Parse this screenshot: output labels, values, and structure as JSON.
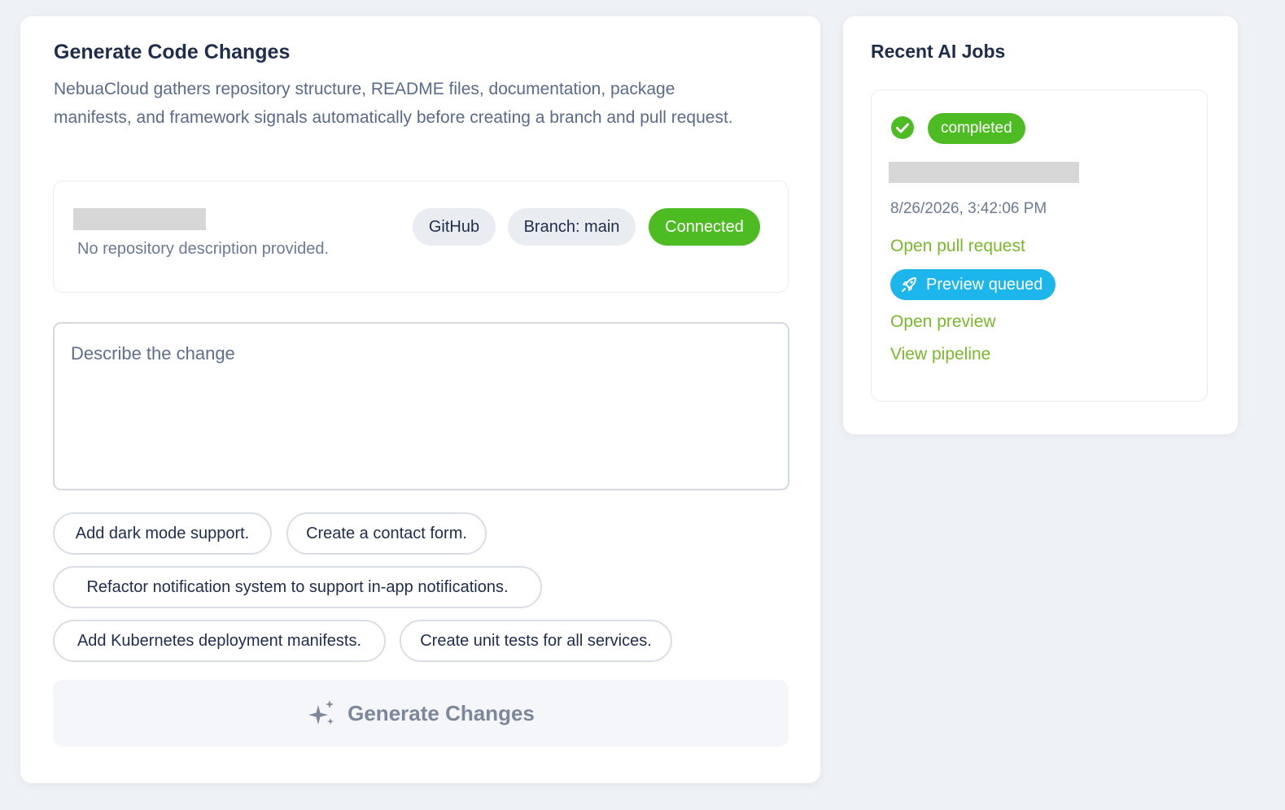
{
  "main": {
    "title": "Generate Code Changes",
    "description": "NebuaCloud gathers repository structure, README files, documentation, package manifests, and framework signals automatically before creating a branch and pull request.",
    "repo": {
      "description": "No repository description provided.",
      "provider_label": "GitHub",
      "branch_label": "Branch: main",
      "status_label": "Connected"
    },
    "prompt": {
      "placeholder": "Describe the change",
      "value": ""
    },
    "suggestions": [
      "Add dark mode support.",
      "Create a contact form.",
      "Refactor notification system to support in-app notifications.",
      "Add Kubernetes deployment manifests.",
      "Create unit tests for all services."
    ],
    "generate_button": {
      "label": "Generate Changes",
      "icon": "sparkles-icon"
    }
  },
  "jobs": {
    "title": "Recent AI Jobs",
    "items": [
      {
        "status_icon": "check-circle-icon",
        "status": "completed",
        "timestamp": "8/26/2026, 3:42:06 PM",
        "pull_request_link": "Open pull request",
        "preview_badge": "Preview queued",
        "preview_icon": "rocket-icon",
        "preview_link": "Open preview",
        "pipeline_link": "View pipeline"
      }
    ]
  },
  "colors": {
    "accent_green": "#4cbc22",
    "link_green": "#7ab82a",
    "preview_blue": "#1db6ec",
    "text_dark": "#1f2d4d",
    "text_muted": "#5a6b8a",
    "background": "#eef1f5"
  }
}
